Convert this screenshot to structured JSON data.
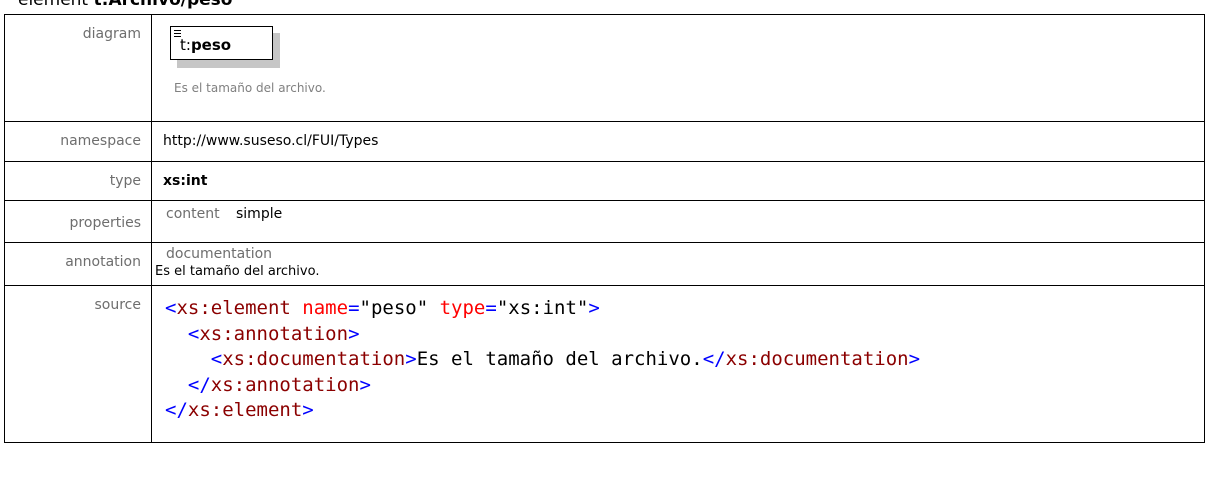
{
  "heading": {
    "prefix": "element",
    "name": "t:Archivo/peso"
  },
  "diagram": {
    "label": "diagram",
    "element_prefix": "t:",
    "element_name": "peso",
    "caption": "Es el tamaño del archivo."
  },
  "namespace": {
    "label": "namespace",
    "value": "http://www.suseso.cl/FUI/Types"
  },
  "type": {
    "label": "type",
    "value": "xs:int"
  },
  "properties": {
    "label": "properties",
    "key": "content",
    "value": "simple"
  },
  "annotation": {
    "label": "annotation",
    "key": "documentation",
    "value": "Es el tamaño del archivo."
  },
  "source": {
    "label": "source",
    "l1": {
      "tag": "xs:element",
      "attr1": "name",
      "val1": "\"peso\"",
      "attr2": "type",
      "val2": "\"xs:int\""
    },
    "l2": {
      "tag": "xs:annotation"
    },
    "l3": {
      "open_tag": "xs:documentation",
      "text": "Es el tamaño del archivo.",
      "close_tag": "xs:documentation"
    },
    "l4": {
      "tag": "xs:annotation"
    },
    "l5": {
      "tag": "xs:element"
    }
  },
  "colors": {
    "tag_bracket": "#0000ff",
    "tag_name": "#8b0000",
    "attr_name": "#ff0000",
    "label_gray": "#6e6e6e",
    "shadow": "#c6c6c6"
  }
}
